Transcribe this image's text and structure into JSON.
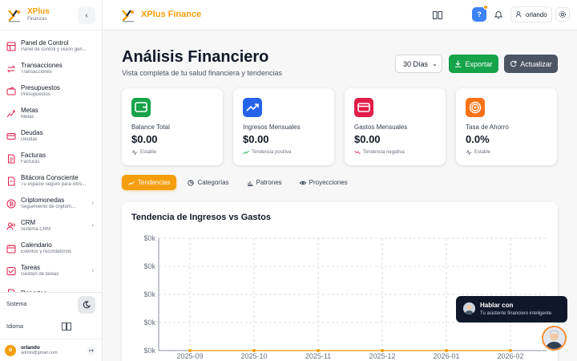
{
  "brand": {
    "name": "XPlus",
    "subtitle": "Finanzas",
    "app_title_a": "XPlus",
    "app_title_b": "Finance"
  },
  "sidebar": {
    "items": [
      {
        "label": "Panel de Control",
        "sub": "Panel de control y visión gen...",
        "icon": "dashboard-icon",
        "has_children": false
      },
      {
        "label": "Transacciones",
        "sub": "Transacciones",
        "icon": "transactions-icon",
        "has_children": false
      },
      {
        "label": "Presupuestos",
        "sub": "Presupuestos",
        "icon": "budget-icon",
        "has_children": false
      },
      {
        "label": "Metas",
        "sub": "Metas",
        "icon": "goals-icon",
        "has_children": false
      },
      {
        "label": "Deudas",
        "sub": "Deudas",
        "icon": "debts-icon",
        "has_children": false
      },
      {
        "label": "Facturas",
        "sub": "Facturas",
        "icon": "invoice-icon",
        "has_children": false
      },
      {
        "label": "Bitácora Consciente",
        "sub": "Tu espacio seguro para intro...",
        "icon": "journal-icon",
        "has_children": false
      },
      {
        "label": "Criptomonedas",
        "sub": "Seguimiento de criptom...",
        "icon": "crypto-icon",
        "has_children": true
      },
      {
        "label": "CRM",
        "sub": "Sistema CRM",
        "icon": "crm-icon",
        "has_children": true
      },
      {
        "label": "Calendario",
        "sub": "Eventos y recordatorios",
        "icon": "calendar-icon",
        "has_children": false
      },
      {
        "label": "Tareas",
        "sub": "Gestión de tareas",
        "icon": "tasks-icon",
        "has_children": true
      },
      {
        "label": "Reportes",
        "sub": "",
        "icon": "reports-icon",
        "has_children": false
      }
    ],
    "system_label": "Sistema",
    "language_label": "Idioma"
  },
  "user": {
    "name": "orlando",
    "email": "admin@gmail.com",
    "initial": "o"
  },
  "header": {
    "user_label": "orlando"
  },
  "page": {
    "title": "Análisis Financiero",
    "subtitle": "Vista completa de tu salud financiera y tendencias"
  },
  "toolbar": {
    "period": "30 Días",
    "export_label": "Exportar",
    "refresh_label": "Actualizar"
  },
  "cards": [
    {
      "label": "Balance Total",
      "value": "$0.00",
      "trend": "Estable",
      "color": "#16a34a",
      "icon": "wallet-icon"
    },
    {
      "label": "Ingresos Mensuales",
      "value": "$0.00",
      "trend": "Tendencia positiva",
      "color": "#2563eb",
      "icon": "trending-up-icon"
    },
    {
      "label": "Gastos Mensuales",
      "value": "$0.00",
      "trend": "Tendencia negativa",
      "color": "#e11d48",
      "icon": "credit-card-icon"
    },
    {
      "label": "Tasa de Ahorro",
      "value": "0.0%",
      "trend": "Estable",
      "color": "#f97316",
      "icon": "target-icon"
    }
  ],
  "tabs": [
    {
      "label": "Tendencias",
      "active": true
    },
    {
      "label": "Categorías",
      "active": false
    },
    {
      "label": "Patrones",
      "active": false
    },
    {
      "label": "Proyecciones",
      "active": false
    }
  ],
  "chart_data": {
    "type": "line",
    "title": "Tendencia de Ingresos vs Gastos",
    "x": [
      "2025-09",
      "2025-10",
      "2025-11",
      "2025-12",
      "2026-01",
      "2026-02"
    ],
    "y_ticks": [
      "$0k",
      "$0k",
      "$0k",
      "$0k",
      "$0k"
    ],
    "series": [
      {
        "values": [
          0,
          0,
          0,
          0,
          0,
          0
        ],
        "color": "#f59e0b"
      }
    ],
    "grid": true
  },
  "chat": {
    "title": "Hablar con",
    "subtitle": "Tu asistente financiero inteligente"
  }
}
